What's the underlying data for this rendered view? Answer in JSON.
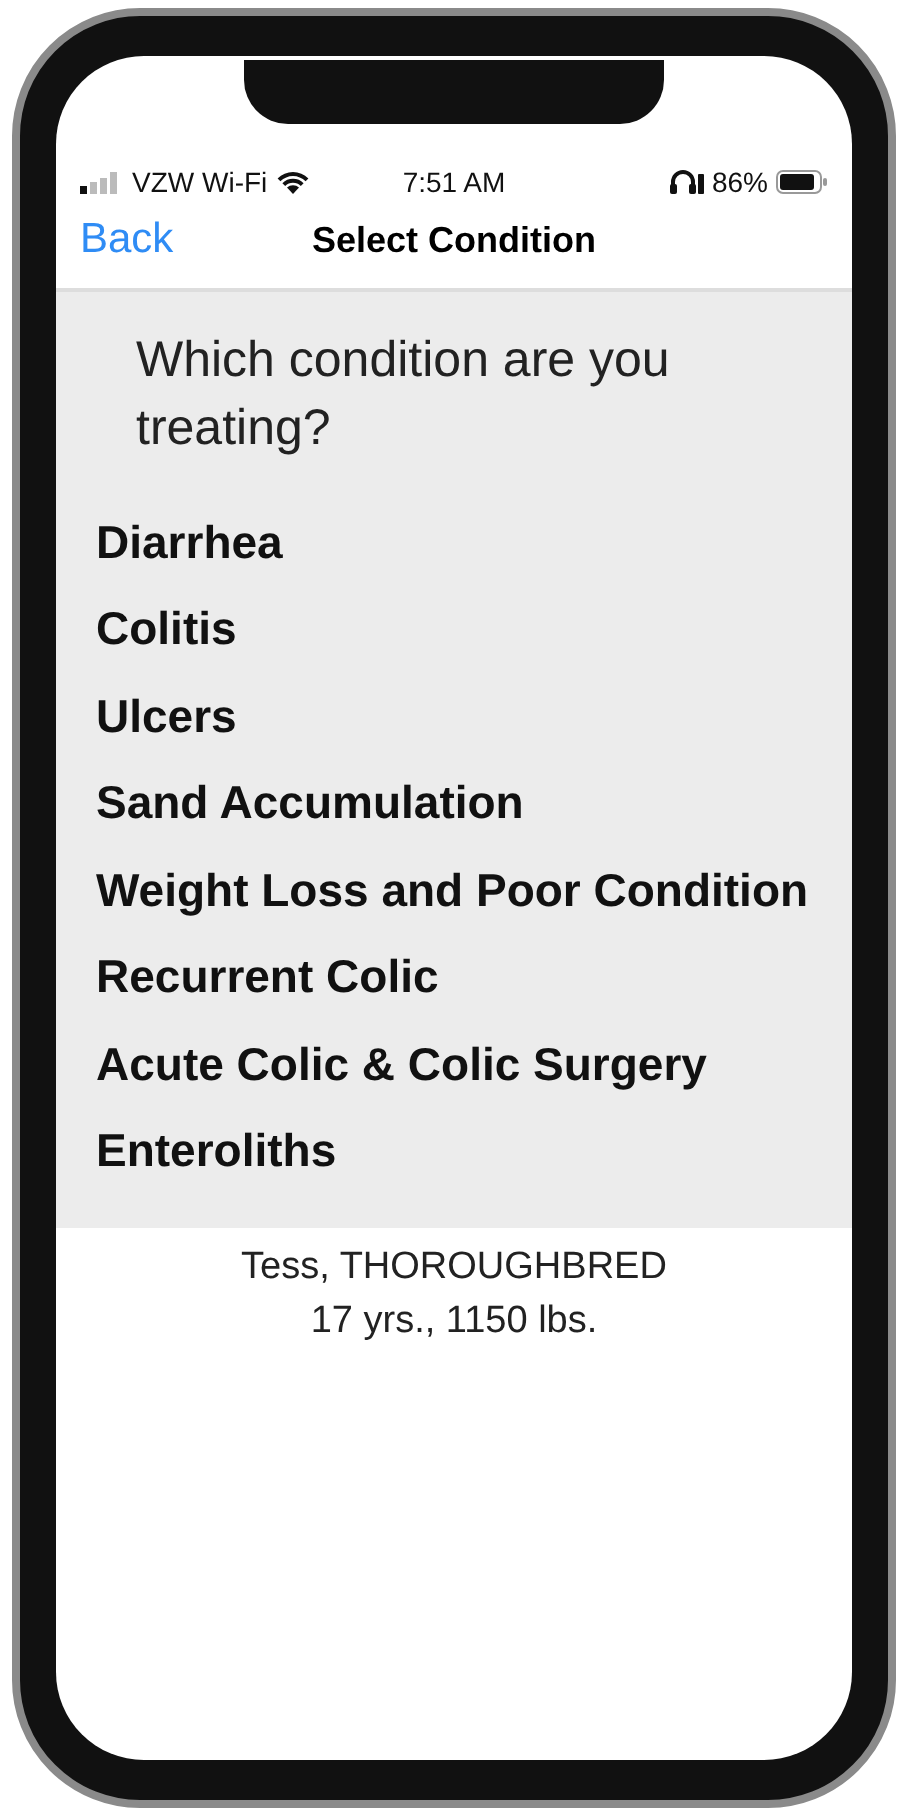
{
  "status_bar": {
    "carrier": "VZW Wi-Fi",
    "time": "7:51 AM",
    "battery": "86%"
  },
  "nav": {
    "back": "Back",
    "title": "Select Condition"
  },
  "question": "Which condition are you treating?",
  "conditions": [
    {
      "label": "Diarrhea"
    },
    {
      "label": "Colitis"
    },
    {
      "label": "Ulcers"
    },
    {
      "label": "Sand Accumulation"
    },
    {
      "label": "Weight Loss and Poor Condition"
    },
    {
      "label": "Recurrent Colic"
    },
    {
      "label": "Acute Colic & Colic Surgery"
    },
    {
      "label": "Enteroliths"
    }
  ],
  "patient": {
    "name_breed": "Tess, THOROUGHBRED",
    "details": "17 yrs., 1150 lbs."
  }
}
